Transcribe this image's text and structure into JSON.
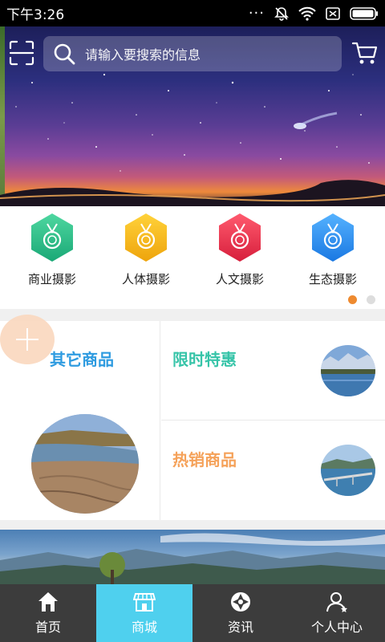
{
  "status_bar": {
    "time": "下午3:26",
    "icons": [
      "more-dots-icon",
      "mute-icon",
      "wifi-icon",
      "sim-icon",
      "battery-icon"
    ]
  },
  "header": {
    "search_placeholder": "请输入要搜索的信息",
    "icons": [
      "scan-icon",
      "search-icon",
      "cart-icon"
    ]
  },
  "categories": [
    {
      "label": "商业摄影",
      "icon": "medal-icon",
      "color": "#2bbf8a"
    },
    {
      "label": "人体摄影",
      "icon": "medal-icon",
      "color": "#f0b21c"
    },
    {
      "label": "人文摄影",
      "icon": "medal-icon",
      "color": "#ec3a52"
    },
    {
      "label": "生态摄影",
      "icon": "medal-icon",
      "color": "#2f8ff0"
    }
  ],
  "pager": {
    "count": 2,
    "active": 0
  },
  "products": {
    "left_title": "其它商品",
    "right_top_title": "限时特惠",
    "right_bottom_title": "热销商品"
  },
  "tabs": [
    {
      "label": "首页",
      "icon": "home-icon",
      "active": false
    },
    {
      "label": "商城",
      "icon": "store-icon",
      "active": true
    },
    {
      "label": "资讯",
      "icon": "aperture-icon",
      "active": false
    },
    {
      "label": "个人中心",
      "icon": "user-icon",
      "active": false
    }
  ],
  "colors": {
    "accent_tab": "#4fd0ee",
    "pager_active": "#ee8a2f",
    "left_title": "#2e9be0",
    "right_top_title": "#36c4a8",
    "right_bottom_title": "#f5a25a"
  }
}
